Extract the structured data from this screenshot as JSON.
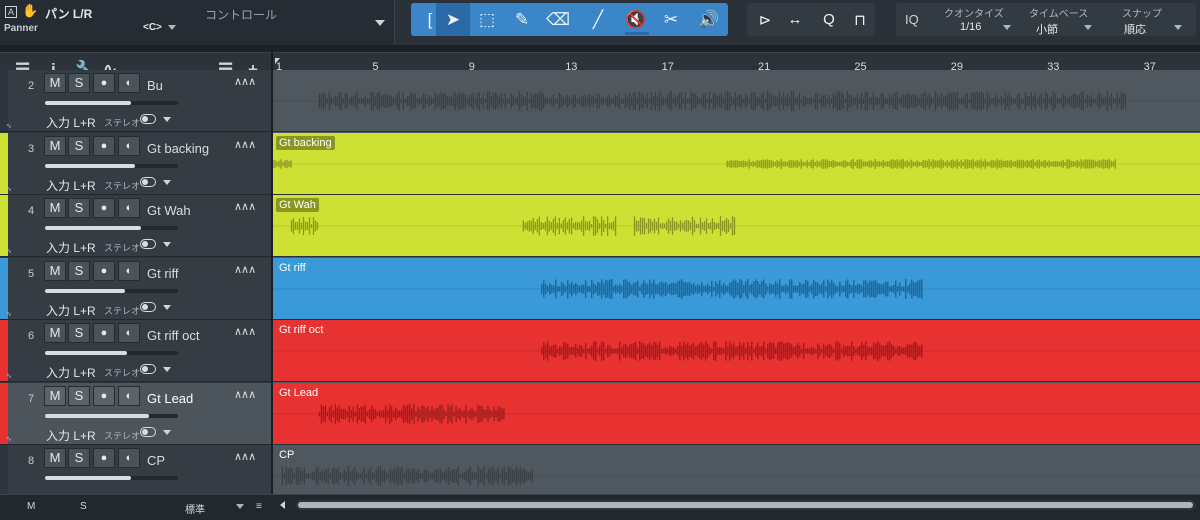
{
  "context_bar": {
    "a_badge": "A",
    "pan_label": "パン L/R",
    "panner_label": "Panner",
    "control_value": "<C>",
    "control_label": "コントロール",
    "hand_icon": "hand-icon"
  },
  "tools": [
    {
      "name": "range-tool",
      "glyph": "[",
      "active": false
    },
    {
      "name": "arrow-tool",
      "glyph": "➤",
      "active": true
    },
    {
      "name": "select-tool",
      "glyph": "⬚",
      "active": false
    },
    {
      "name": "pencil-tool",
      "glyph": "✎",
      "active": false
    },
    {
      "name": "eraser-tool",
      "glyph": "⌫",
      "active": false
    },
    {
      "name": "paint-tool",
      "glyph": "╱",
      "active": false
    },
    {
      "name": "mute-tool",
      "glyph": "🔇",
      "active": false
    },
    {
      "name": "split-tool",
      "glyph": "✂",
      "active": false
    },
    {
      "name": "listen-tool",
      "glyph": "🔊",
      "active": false
    }
  ],
  "edit_tools": [
    {
      "name": "bend-tool",
      "glyph": "⊳"
    },
    {
      "name": "stretch-tool",
      "glyph": "↔"
    },
    {
      "name": "quantize-button",
      "glyph": "Q"
    },
    {
      "name": "snap-toggle",
      "glyph": "⊓"
    }
  ],
  "quantize": {
    "iq_label": "IQ",
    "quantize_label": "クオンタイズ",
    "quantize_value": "1/16",
    "timebase_label": "タイムベース",
    "timebase_value": "小節",
    "snap_label": "スナップ",
    "snap_value": "順応"
  },
  "header": {
    "icons": [
      "list-icon",
      "info-icon",
      "wrench-icon",
      "automation-icon",
      "menu-icon",
      "add-icon"
    ]
  },
  "ruler": {
    "bars": [
      "1",
      "5",
      "9",
      "13",
      "17",
      "21",
      "25",
      "29",
      "33",
      "37"
    ]
  },
  "tracks": [
    {
      "num": "2",
      "name": "Bu",
      "color": "#50585f",
      "strip": "#2e353c",
      "fader": 0.65,
      "selected": false,
      "clip_label": "",
      "input": "入力 L+R",
      "stereo": "ステレオ",
      "wave_color": "#3a4046",
      "wave_segments": [
        [
          0.05,
          0.92
        ]
      ]
    },
    {
      "num": "3",
      "name": "Gt backing",
      "color": "#cde034",
      "strip": "#cde034",
      "fader": 0.68,
      "selected": false,
      "clip_label": "Gt backing",
      "input": "入力 L+R",
      "stereo": "ステレオ",
      "wave_color": "#8a9620",
      "wave_segments": [
        [
          0.0,
          0.02
        ],
        [
          0.49,
          0.91
        ]
      ]
    },
    {
      "num": "4",
      "name": "Gt Wah",
      "color": "#cde034",
      "strip": "#cde034",
      "fader": 0.72,
      "selected": false,
      "clip_label": "Gt Wah",
      "input": "入力 L+R",
      "stereo": "ステレオ",
      "wave_color": "#8a9620",
      "wave_segments": [
        [
          0.02,
          0.05
        ],
        [
          0.27,
          0.32
        ],
        [
          0.32,
          0.37
        ],
        [
          0.39,
          0.5
        ]
      ]
    },
    {
      "num": "5",
      "name": "Gt riff",
      "color": "#3a9ad9",
      "strip": "#3a9ad9",
      "fader": 0.6,
      "selected": false,
      "clip_label": "Gt riff",
      "input": "入力 L+R",
      "stereo": "ステレオ",
      "wave_color": "#1d5f8f",
      "wave_segments": [
        [
          0.29,
          0.7
        ]
      ]
    },
    {
      "num": "6",
      "name": "Gt riff oct",
      "color": "#e83131",
      "strip": "#e83131",
      "fader": 0.62,
      "selected": false,
      "clip_label": "Gt riff oct",
      "input": "入力 L+R",
      "stereo": "ステレオ",
      "wave_color": "#9a1c1c",
      "wave_segments": [
        [
          0.29,
          0.7
        ]
      ]
    },
    {
      "num": "7",
      "name": "Gt Lead",
      "color": "#e83131",
      "strip": "#e83131",
      "fader": 0.78,
      "selected": true,
      "clip_label": "Gt Lead",
      "input": "入力 L+R",
      "stereo": "ステレオ",
      "wave_color": "#9a1c1c",
      "wave_segments": [
        [
          0.05,
          0.1
        ],
        [
          0.1,
          0.15
        ],
        [
          0.15,
          0.25
        ]
      ]
    },
    {
      "num": "8",
      "name": "CP",
      "color": "#50585f",
      "strip": "#2e353c",
      "fader": 0.65,
      "selected": false,
      "clip_label": "CP",
      "input": "",
      "stereo": "",
      "wave_color": "#3a4046",
      "wave_segments": [
        [
          0.01,
          0.28
        ]
      ]
    }
  ],
  "bottom_bar": {
    "m_label": "M",
    "s_label": "S",
    "view_label": "標準"
  }
}
